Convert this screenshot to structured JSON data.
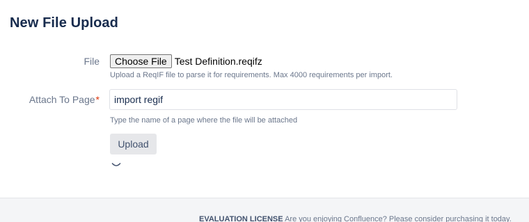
{
  "page": {
    "title": "New File Upload"
  },
  "form": {
    "file": {
      "label": "File",
      "button_label": "Choose File",
      "selected_file": "Test Definition.reqifz",
      "help": "Upload a ReqIF file to parse it for requirements. Max 4000 requirements per import."
    },
    "attach": {
      "label": "Attach To Page",
      "required_marker": "*",
      "value": "import regif",
      "help": "Type the name of a page where the file will be attached"
    },
    "submit_label": "Upload",
    "loading_icon": "spinner-icon"
  },
  "footer": {
    "license_label": "EVALUATION LICENSE",
    "message": "Are you enjoying Confluence? Please consider purchasing it today."
  },
  "colors": {
    "text": "#172b4d",
    "label": "#6b778c",
    "required": "#de350b",
    "button_bg": "#e6e7ea",
    "footer_bg": "#f4f5f7"
  }
}
